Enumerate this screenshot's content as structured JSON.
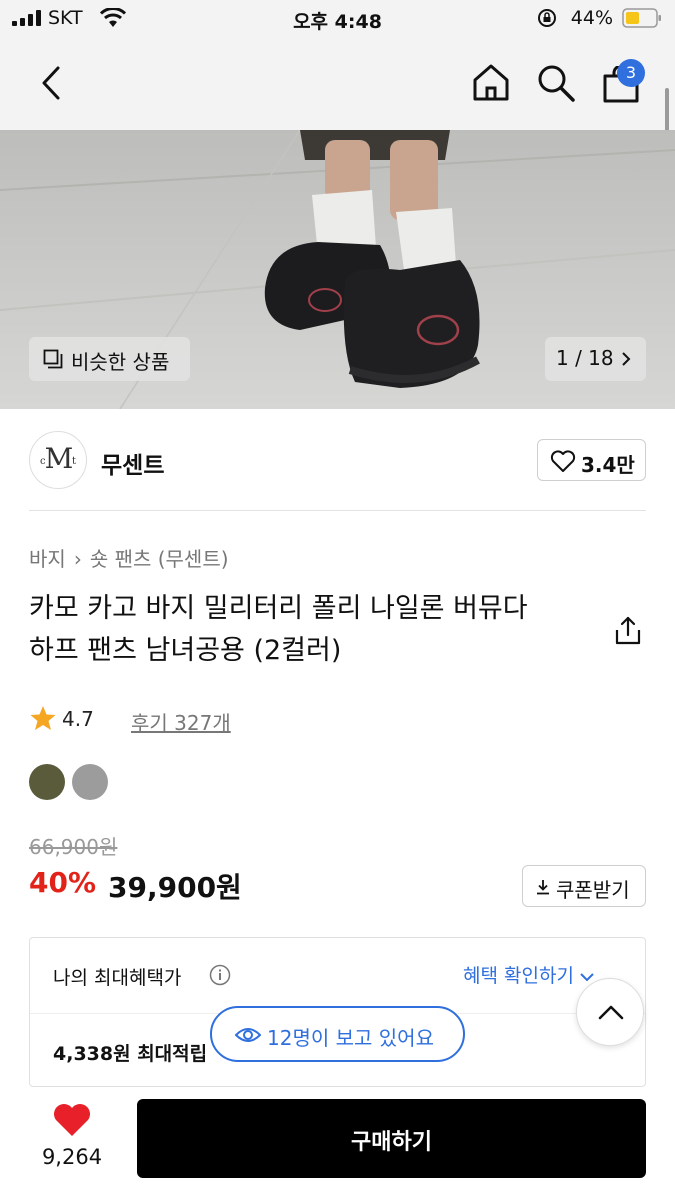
{
  "status_bar": {
    "carrier": "SKT",
    "time": "오후 4:48",
    "battery": "44%"
  },
  "navbar": {
    "back_icon": "chevron-left-icon",
    "home_icon": "home-icon",
    "search_icon": "search-icon",
    "cart_icon": "shopping-bag-icon",
    "cart_badge": "3"
  },
  "hero": {
    "similar_label": "비슷한 상품",
    "pager": "1 / 18"
  },
  "brand": {
    "logo_text": "M",
    "logo_small_left": "c",
    "logo_small_right": "t",
    "name": "무센트",
    "likes": "3.4만"
  },
  "product": {
    "breadcrumb": [
      "바지",
      "숏 팬츠 (무센트)"
    ],
    "title_line1": "카모 카고 바지 밀리터리 폴리 나일론 버뮤다",
    "title_line2": "하프 팬츠 남녀공용 (2컬러)",
    "rating": "4.7",
    "review_label": "후기 327개",
    "colors": [
      "#5a5b3a",
      "#9c9c9c"
    ],
    "original_price": "66,900원",
    "discount": "40%",
    "price": "39,900원",
    "coupon_label": "쿠폰받기"
  },
  "benefit": {
    "header": "나의 최대혜택가",
    "check_label": "혜택 확인하기",
    "points": "4,338원 최대적립"
  },
  "viewers_label": "12명이 보고 있어요",
  "bottom": {
    "like_count": "9,264",
    "buy_label": "구매하기"
  },
  "colors": {
    "accent_blue": "#2f6fde",
    "discount_red": "#e2231a",
    "heart_red": "#e8202a"
  }
}
